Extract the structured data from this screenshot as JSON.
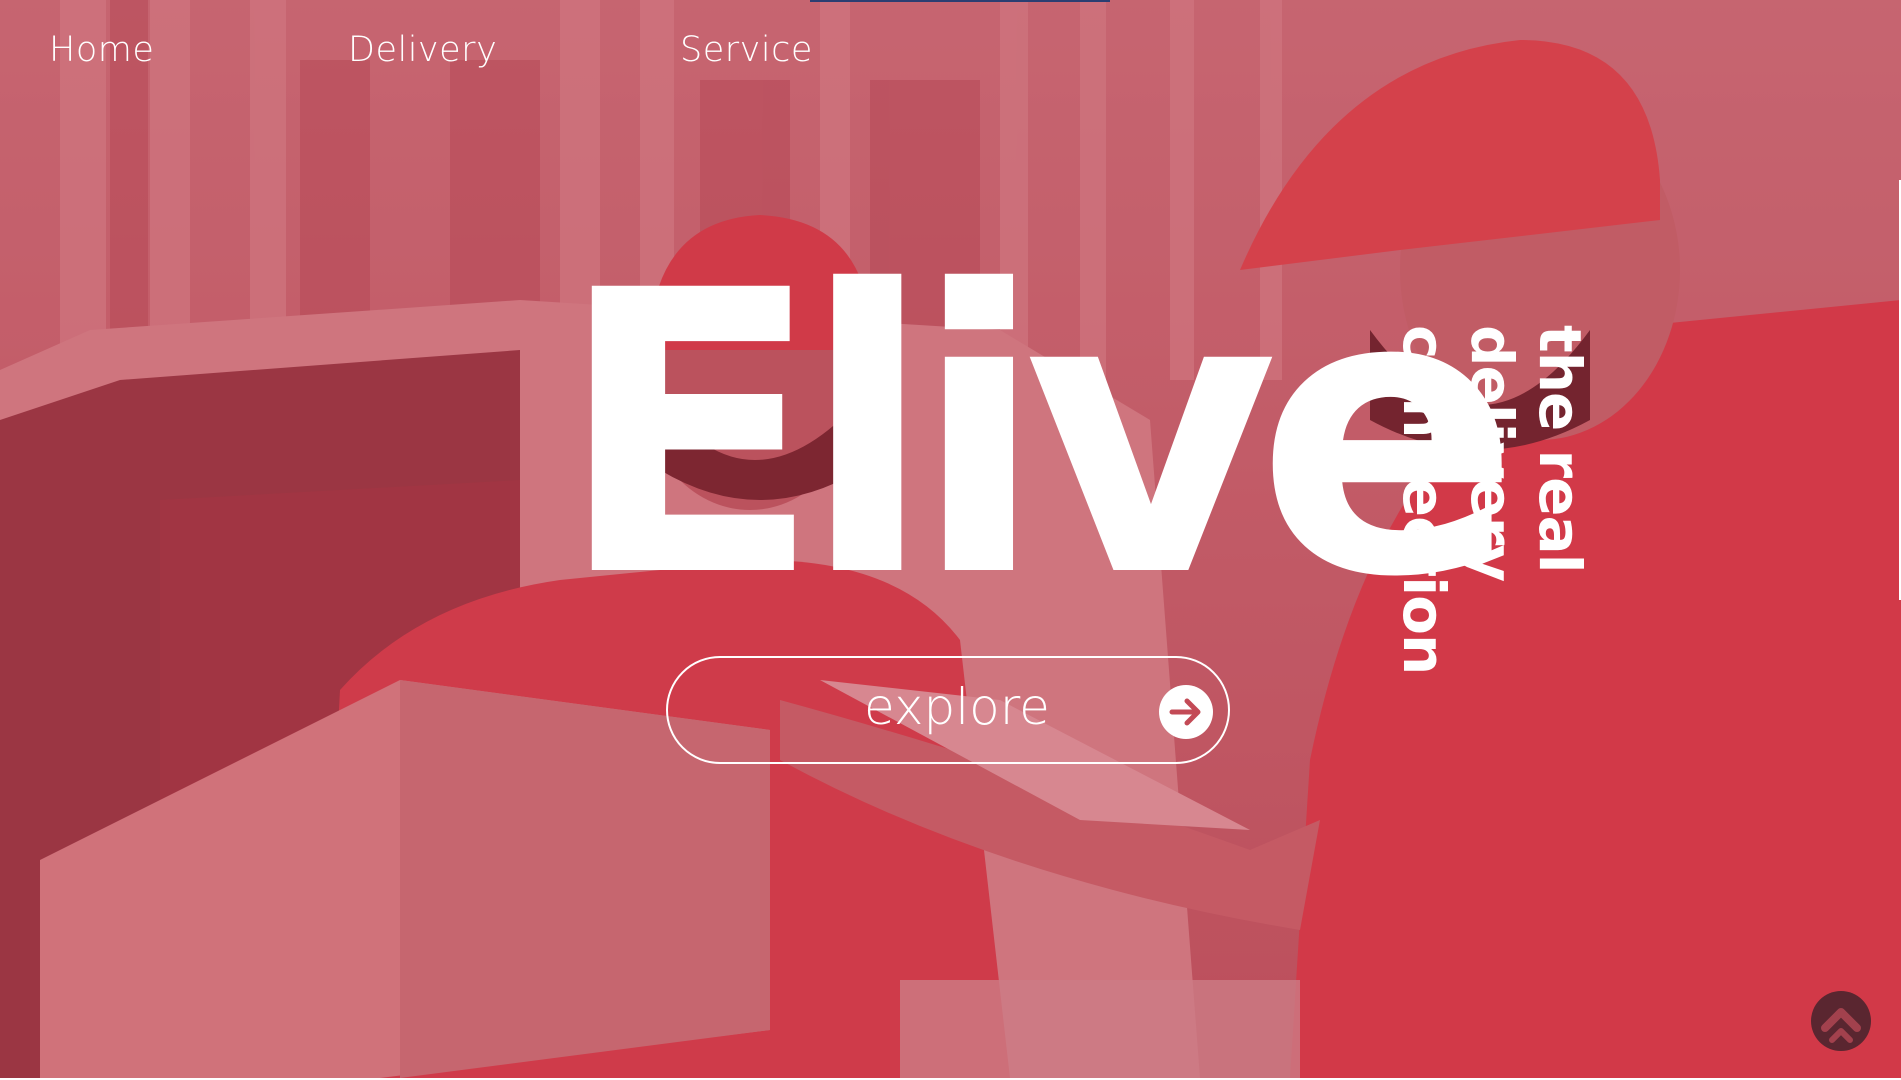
{
  "nav": {
    "home": "Home",
    "delivery": "Delivery",
    "service": "Service"
  },
  "hero": {
    "brand": "Elive",
    "tagline": [
      "the real",
      "delivery",
      "connection"
    ],
    "explore_label": "explore",
    "explore_icon": "arrow-right-circle-icon",
    "background": "photo of two delivery workers in red uniforms handling cardboard boxes beside a van"
  },
  "scroll_top": {
    "icon": "chevron-up-circle-icon"
  },
  "colors": {
    "overlay": "#c43246",
    "text": "#ffffff",
    "scroll_button": "#5a2630",
    "accent_bar": "#2b3e72"
  }
}
